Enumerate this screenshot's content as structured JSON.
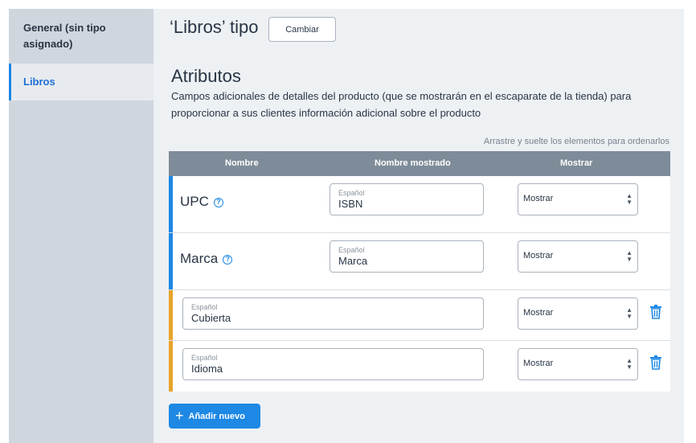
{
  "sidebar": {
    "items": [
      {
        "label": "General (sin tipo asignado)"
      },
      {
        "label": "Libros"
      }
    ]
  },
  "header": {
    "type_title": "‘Libros’ tipo",
    "change_label": "Cambiar"
  },
  "attributes": {
    "title": "Atributos",
    "description": "Campos adicionales de detalles del producto (que se mostrarán en el escaparate de la tienda) para proporcionar a sus clientes información adicional sobre el producto",
    "drag_hint": "Arrastre y suelte los elementos para ordenarlos",
    "columns": [
      "Nombre",
      "Nombre mostrado",
      "Mostrar"
    ],
    "rows": [
      {
        "name": "UPC",
        "lang": "Español",
        "display_name": "ISBN",
        "show": "Mostrar"
      },
      {
        "name": "Marca",
        "lang": "Español",
        "display_name": "Marca",
        "show": "Mostrar"
      },
      {
        "lang": "Español",
        "value": "Cubierta",
        "show": "Mostrar"
      },
      {
        "lang": "Español",
        "value": "Idioma",
        "show": "Mostrar"
      }
    ],
    "add_label": "Añadir nuevo"
  },
  "colors": {
    "accent": "#1e88e5",
    "custom_bar": "#e8a42c",
    "header_bg": "#7e8c99"
  }
}
